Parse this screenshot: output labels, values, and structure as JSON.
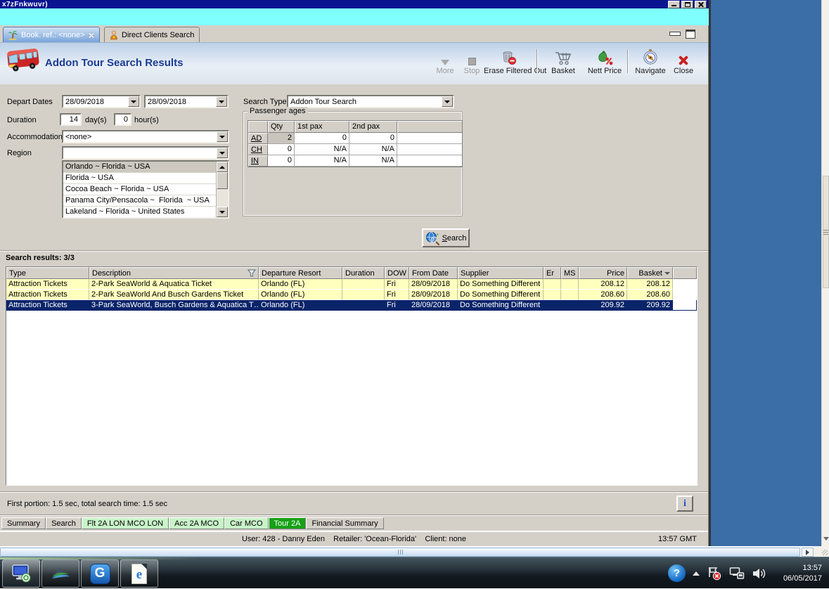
{
  "window": {
    "title": "x7zFnkwuvr)"
  },
  "tabs": {
    "booking": "Book. ref.: <none>",
    "direct_clients": "Direct Clients Search"
  },
  "header": {
    "title": "Addon Tour Search Results"
  },
  "toolbar": {
    "more": "More",
    "stop": "Stop",
    "erase_filtered_out": "Erase Filtered Out",
    "basket": "Basket",
    "nett_price": "Nett Price",
    "navigate": "Navigate",
    "close": "Close"
  },
  "form": {
    "depart_dates_label": "Depart Dates",
    "depart_date_from": "28/09/2018",
    "depart_date_to": "28/09/2018",
    "search_type_label": "Search Type",
    "search_type_value": "Addon Tour Search",
    "duration_label": "Duration",
    "duration_days": "14",
    "days_unit": "day(s)",
    "duration_hours": "0",
    "hours_unit": "hour(s)",
    "accommodation_label": "Accommodation",
    "accommodation_value": "<none>",
    "region_label": "Region",
    "region_value": "",
    "region_list": [
      "Orlando ~ Florida ~ USA",
      "Florida ~ USA",
      "Cocoa Beach ~ Florida ~ USA",
      "Panama City/Pensacola ~  Florida  ~ USA",
      "Lakeland ~ Florida ~ United States"
    ],
    "search_button": "Search"
  },
  "passenger_ages": {
    "title": "Passenger ages",
    "columns": [
      "Qty",
      "1st pax",
      "2nd pax"
    ],
    "rows": [
      {
        "code": "AD",
        "qty": "2",
        "pax1": "0",
        "pax2": "0"
      },
      {
        "code": "CH",
        "qty": "0",
        "pax1": "N/A",
        "pax2": "N/A"
      },
      {
        "code": "IN",
        "qty": "0",
        "pax1": "N/A",
        "pax2": "N/A"
      }
    ]
  },
  "results": {
    "label": "Search results: 3/3",
    "columns": [
      "Type",
      "Description",
      "Departure Resort",
      "Duration",
      "DOW",
      "From Date",
      "Supplier",
      "Er",
      "MS",
      "Price",
      "Basket"
    ],
    "rows": [
      [
        "Attraction Tickets",
        "2-Park SeaWorld & Aquatica Ticket",
        "Orlando (FL)",
        "",
        "Fri",
        "28/09/2018",
        "Do Something Different",
        "",
        "",
        "208.12",
        "208.12"
      ],
      [
        "Attraction Tickets",
        "2-Park SeaWorld And Busch Gardens Ticket",
        "Orlando (FL)",
        "",
        "Fri",
        "28/09/2018",
        "Do Something Different",
        "",
        "",
        "208.60",
        "208.60"
      ],
      [
        "Attraction Tickets",
        "3-Park SeaWorld, Busch Gardens & Aquatica T…",
        "Orlando (FL)",
        "",
        "Fri",
        "28/09/2018",
        "Do Something Different",
        "",
        "",
        "209.92",
        "209.92"
      ]
    ]
  },
  "status": {
    "timing": "First portion: 1.5 sec, total search time: 1.5 sec",
    "info_glyph": "i"
  },
  "bottom_tabs": [
    "Summary",
    "Search",
    "Flt 2A LON MCO LON",
    "Acc 2A MCO",
    "Car MCO",
    "Tour 2A",
    "Financial Summary"
  ],
  "statusbar": {
    "user_info": "User: 428 - Danny Eden    Retailer: 'Ocean-Florida'    Client: none",
    "gmt_time": "13:57 GMT"
  },
  "taskbar": {
    "clock_time": "13:57",
    "clock_date": "06/05/2017",
    "help_glyph": "?",
    "g_app_glyph": "G",
    "ie_glyph": "e"
  },
  "colors": {
    "titlebar": "#0a1490",
    "cyan_strip": "#80ffff",
    "desktop": "#3b6da6",
    "selected_row": "#0a246a",
    "result_row": "#ffffbe",
    "tab_green_selected": "#17a117",
    "tab_green_light": "#c9f3c9"
  }
}
